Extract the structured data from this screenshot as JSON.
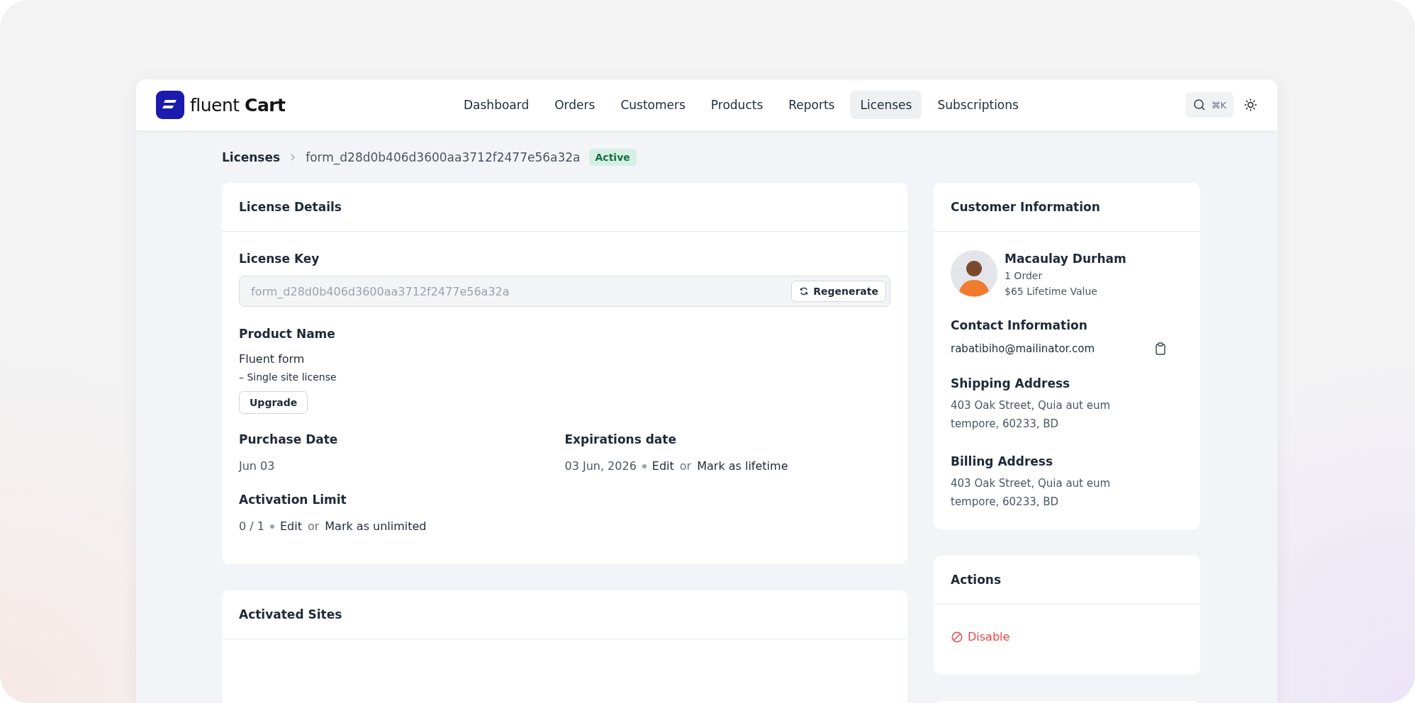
{
  "brand": {
    "text": "fluent **Cart**"
  },
  "nav": [
    {
      "label": "Dashboard",
      "selected": false
    },
    {
      "label": "Orders",
      "selected": false
    },
    {
      "label": "Customers",
      "selected": false
    },
    {
      "label": "Products",
      "selected": false
    },
    {
      "label": "Reports",
      "selected": false
    },
    {
      "label": "Licenses",
      "selected": true
    },
    {
      "label": "Subscriptions",
      "selected": false
    }
  ],
  "search": {
    "shortcut": "⌘K"
  },
  "breadcrumb": {
    "parent": "Licenses",
    "current": "form_d28d0b406d3600aa3712f2477e56a32a",
    "status": "Active"
  },
  "license_details": {
    "title": "License Details",
    "license_key": {
      "label": "License Key",
      "value": "form_d28d0b406d3600aa3712f2477e56a32a",
      "button": "Regenerate"
    },
    "product": {
      "label": "Product Name",
      "name": "Fluent form",
      "variation": "– Single site license",
      "button": "Upgrade"
    },
    "purchase_date": {
      "label": "Purchase Date",
      "value": "Jun 03"
    },
    "expiration": {
      "label": "Expirations date",
      "value": "03 Jun, 2026",
      "edit": "Edit",
      "or": "or",
      "mark": "Mark as lifetime"
    },
    "activation_limit": {
      "label": "Activation Limit",
      "value": "0 / 1",
      "edit": "Edit",
      "or": "or",
      "mark": "Mark as unlimited"
    }
  },
  "activated_sites": {
    "title": "Activated Sites"
  },
  "customer": {
    "title": "Customer Information",
    "name": "Macaulay Durham",
    "orders": "1 Order",
    "lifetime_value": "$65 Lifetime Value",
    "contact": {
      "label": "Contact Information",
      "email": "rabatibiho@mailinator.com"
    },
    "shipping": {
      "label": "Shipping Address",
      "address": "403 Oak Street, Quia aut eum tempore, 60233, BD"
    },
    "billing": {
      "label": "Billing Address",
      "address": "403 Oak Street, Quia aut eum tempore, 60233, BD"
    }
  },
  "actions": {
    "title": "Actions",
    "items": [
      {
        "label": "Disable",
        "kind": "danger"
      }
    ]
  }
}
